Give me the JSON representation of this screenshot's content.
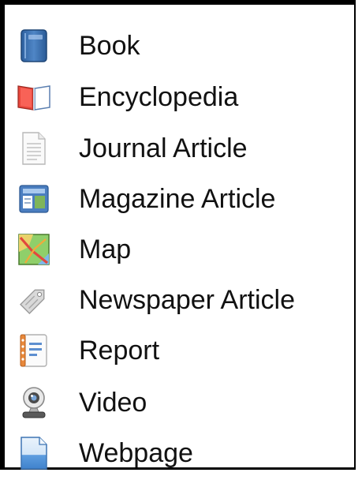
{
  "menu": {
    "items": [
      {
        "label": "Book",
        "icon": "book-icon"
      },
      {
        "label": "Encyclopedia",
        "icon": "open-book-icon"
      },
      {
        "label": "Journal Article",
        "icon": "document-icon"
      },
      {
        "label": "Magazine Article",
        "icon": "magazine-icon"
      },
      {
        "label": "Map",
        "icon": "map-icon"
      },
      {
        "label": "Newspaper Article",
        "icon": "tag-icon"
      },
      {
        "label": "Report",
        "icon": "notepad-icon"
      },
      {
        "label": "Video",
        "icon": "webcam-icon"
      },
      {
        "label": "Webpage",
        "icon": "webpage-icon"
      }
    ]
  }
}
